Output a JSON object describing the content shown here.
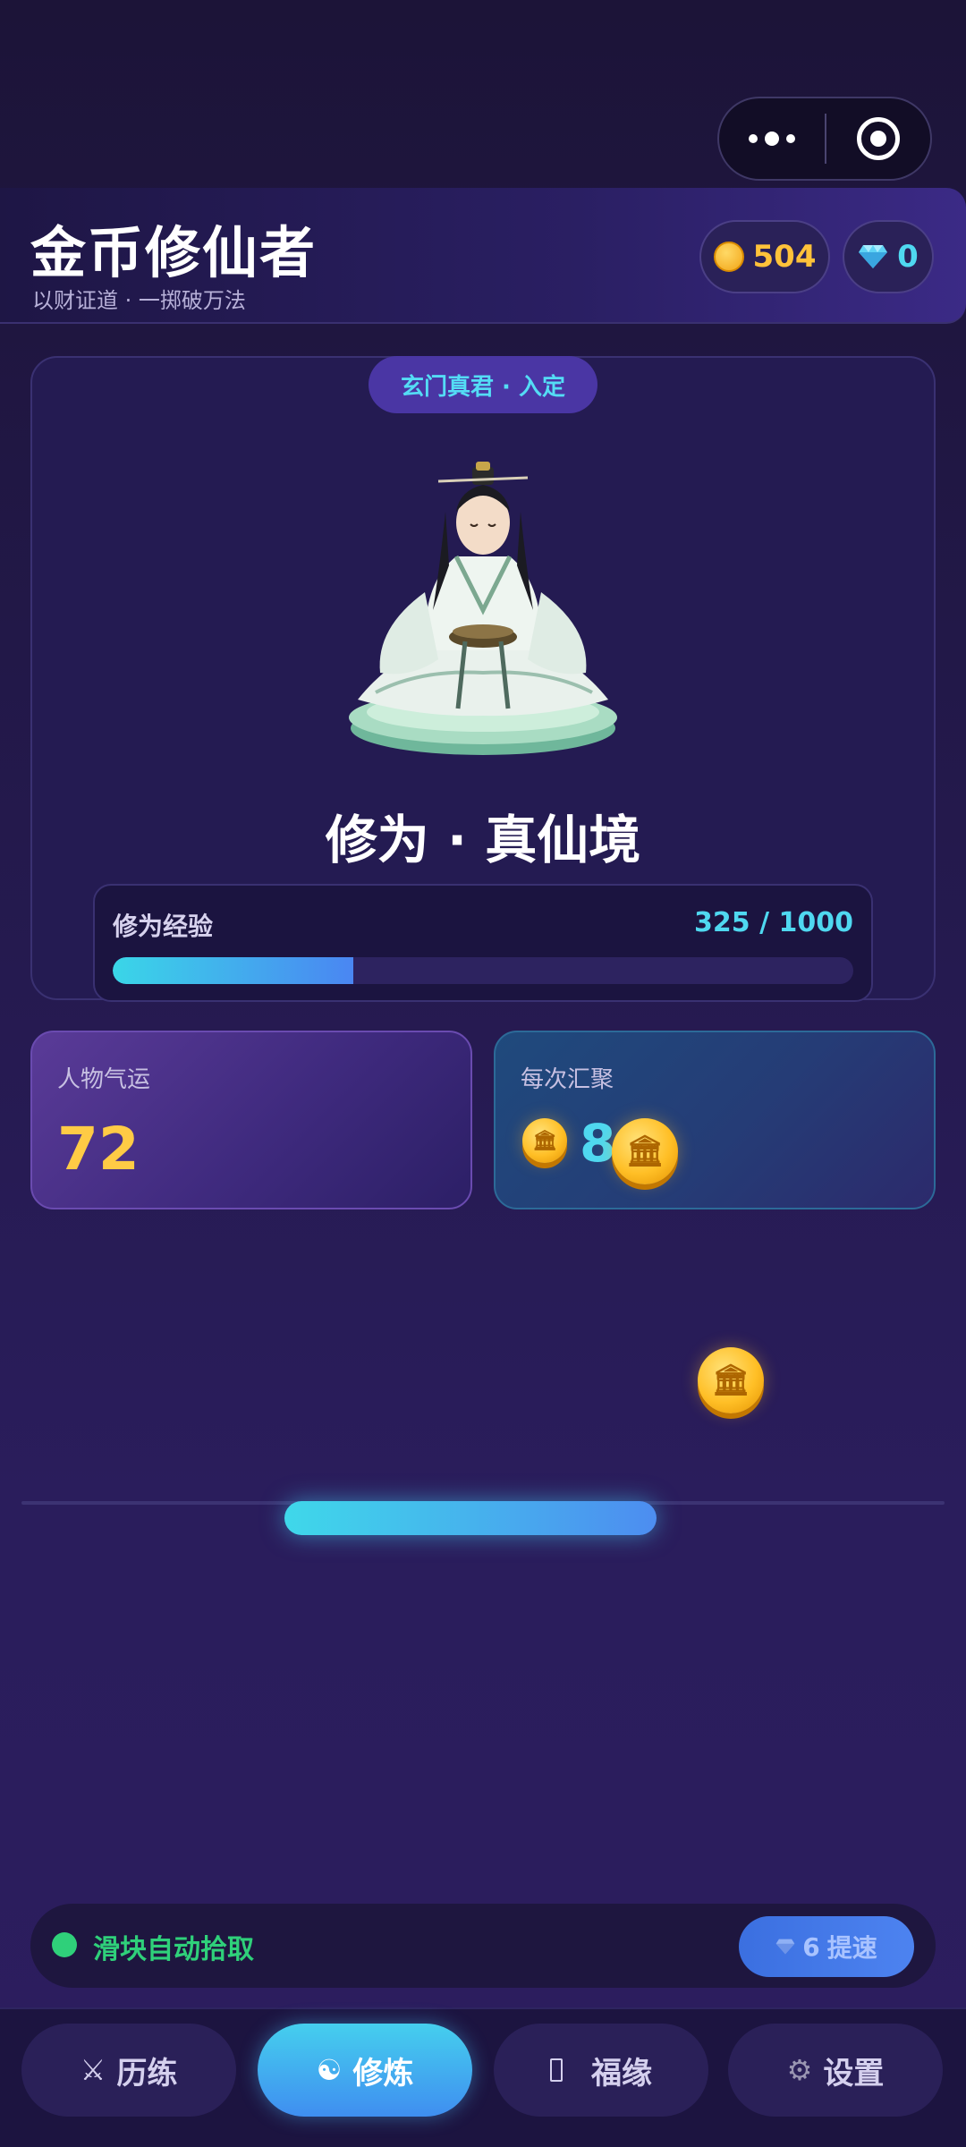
{
  "header": {
    "title": "金币修仙者",
    "subtitle": "以财证道 · 一掷破万法",
    "gold": "504",
    "gems": "0"
  },
  "cultivation": {
    "badge": "玄门真君 · 入定",
    "realm": "修为 · 真仙境",
    "exp_label": "修为经验",
    "exp_text": "325 / 1000",
    "exp_progress": 0.325
  },
  "stats": {
    "luck_label": "人物气运",
    "luck_value": "72",
    "gather_label": "每次汇聚",
    "gather_value": "8"
  },
  "auto_pickup": {
    "label": "滑块自动拾取",
    "boost_count": "6",
    "boost_label": "提速"
  },
  "nav": {
    "items": [
      {
        "label": "历练",
        "icon": "crossed-swords-icon"
      },
      {
        "label": "修炼",
        "icon": "yin-yang-icon"
      },
      {
        "label": "福缘",
        "icon": "missing-glyph-icon"
      },
      {
        "label": "设置",
        "icon": "gear-icon"
      }
    ],
    "active": "修炼"
  },
  "colors": {
    "gold": "#ffc23a",
    "cyan": "#4fd8f0",
    "green": "#2fd07a",
    "accent": "#4a36a4"
  }
}
